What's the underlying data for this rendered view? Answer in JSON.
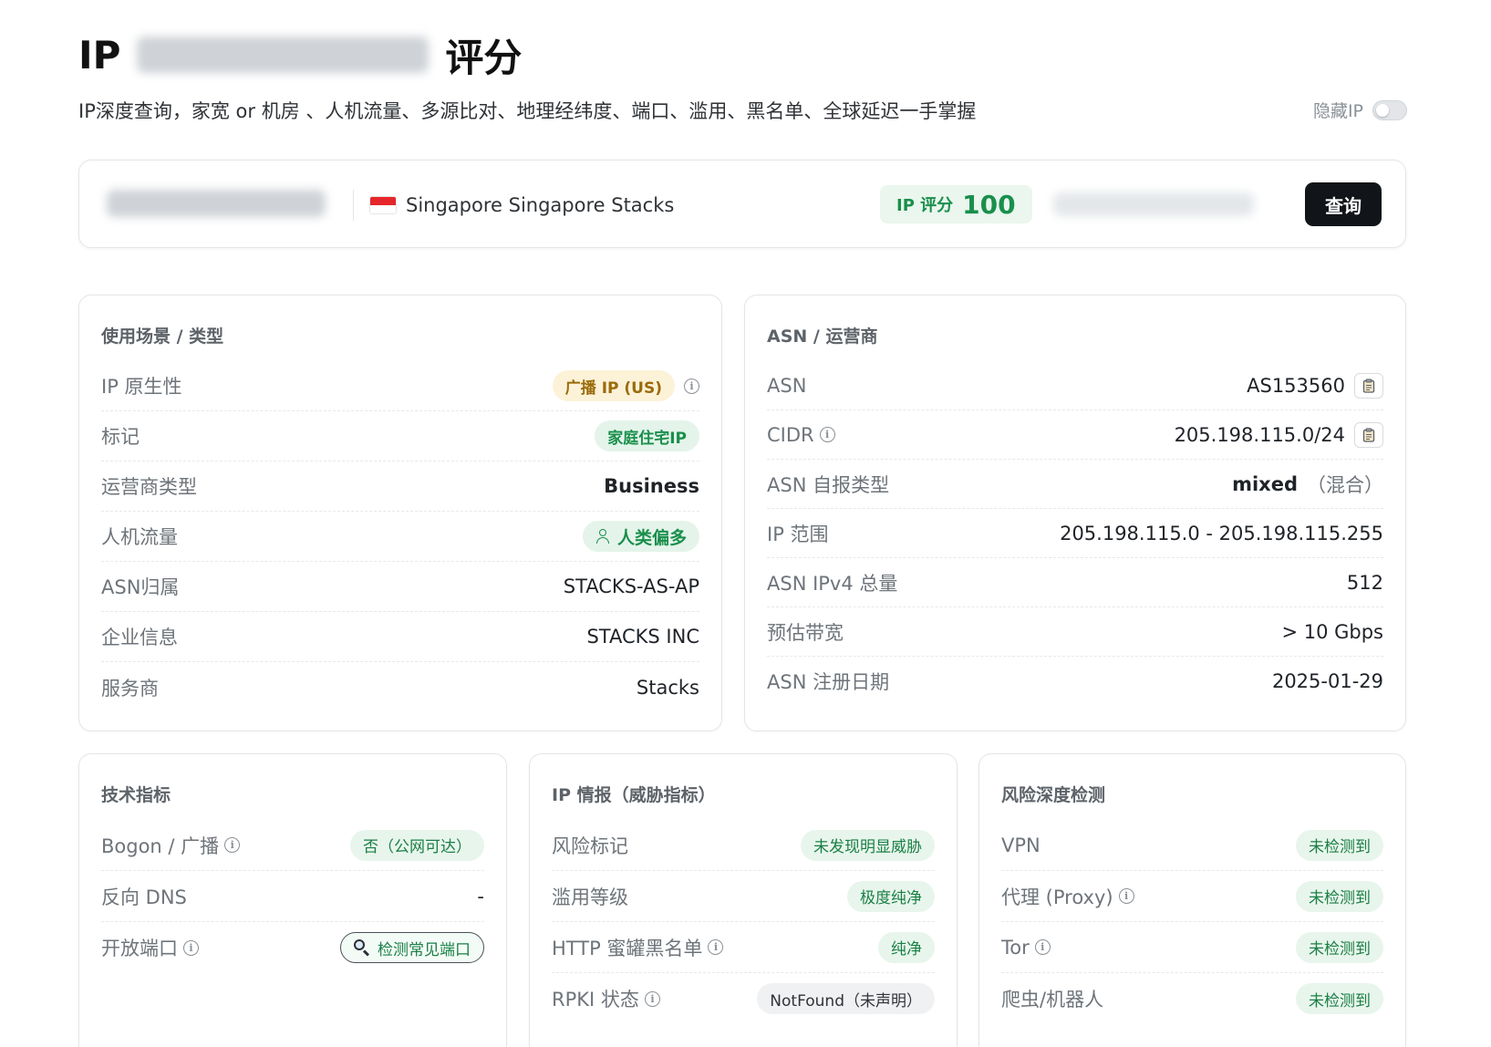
{
  "header": {
    "title_prefix": "IP",
    "title_suffix": "评分",
    "subtitle": "IP深度查询，家宽 or 机房 、人机流量、多源比对、地理经纬度、端口、滥用、黑名单、全球延迟一手掌握",
    "hide_ip_label": "隐藏IP"
  },
  "search_bar": {
    "location": "Singapore Singapore Stacks",
    "score_label": "IP 评分",
    "score_value": "100",
    "query_button": "查询"
  },
  "usage_card": {
    "title": "使用场景 / 类型",
    "rows": [
      {
        "label": "IP 原生性",
        "value": "广播 IP (US)"
      },
      {
        "label": "标记",
        "value": "家庭住宅IP"
      },
      {
        "label": "运营商类型",
        "value": "Business"
      },
      {
        "label": "人机流量",
        "value": "人类偏多"
      },
      {
        "label": "ASN归属",
        "value": "STACKS-AS-AP"
      },
      {
        "label": "企业信息",
        "value": "STACKS INC"
      },
      {
        "label": "服务商",
        "value": "Stacks"
      }
    ]
  },
  "asn_card": {
    "title": "ASN / 运营商",
    "rows": [
      {
        "label": "ASN",
        "value": "AS153560"
      },
      {
        "label": "CIDR",
        "value": "205.198.115.0/24"
      },
      {
        "label": "ASN 自报类型",
        "value": "mixed",
        "value_note": "（混合）"
      },
      {
        "label": "IP 范围",
        "value": "205.198.115.0 - 205.198.115.255"
      },
      {
        "label": "ASN IPv4 总量",
        "value": "512"
      },
      {
        "label": "预估带宽",
        "value": "> 10 Gbps"
      },
      {
        "label": "ASN 注册日期",
        "value": "2025-01-29"
      }
    ]
  },
  "tech_card": {
    "title": "技术指标",
    "rows": [
      {
        "label": "Bogon / 广播",
        "value": "否（公网可达）"
      },
      {
        "label": "反向 DNS",
        "value": "-"
      },
      {
        "label": "开放端口",
        "value": "检测常见端口"
      }
    ]
  },
  "intel_card": {
    "title": "IP 情报（威胁指标）",
    "rows": [
      {
        "label": "风险标记",
        "value": "未发现明显威胁"
      },
      {
        "label": "滥用等级",
        "value": "极度纯净"
      },
      {
        "label": "HTTP 蜜罐黑名单",
        "value": "纯净"
      },
      {
        "label": "RPKI 状态",
        "value": "NotFound（未声明）"
      }
    ]
  },
  "risk_card": {
    "title": "风险深度检测",
    "rows": [
      {
        "label": "VPN",
        "value": "未检测到"
      },
      {
        "label": "代理 (Proxy)",
        "value": "未检测到"
      },
      {
        "label": "Tor",
        "value": "未检测到"
      },
      {
        "label": "爬虫/机器人",
        "value": "未检测到"
      }
    ]
  },
  "colors": {
    "accent_green": "#1a8f4c",
    "query_button_bg": "#111418",
    "warning_yellow_bg": "#fcf2d8"
  }
}
